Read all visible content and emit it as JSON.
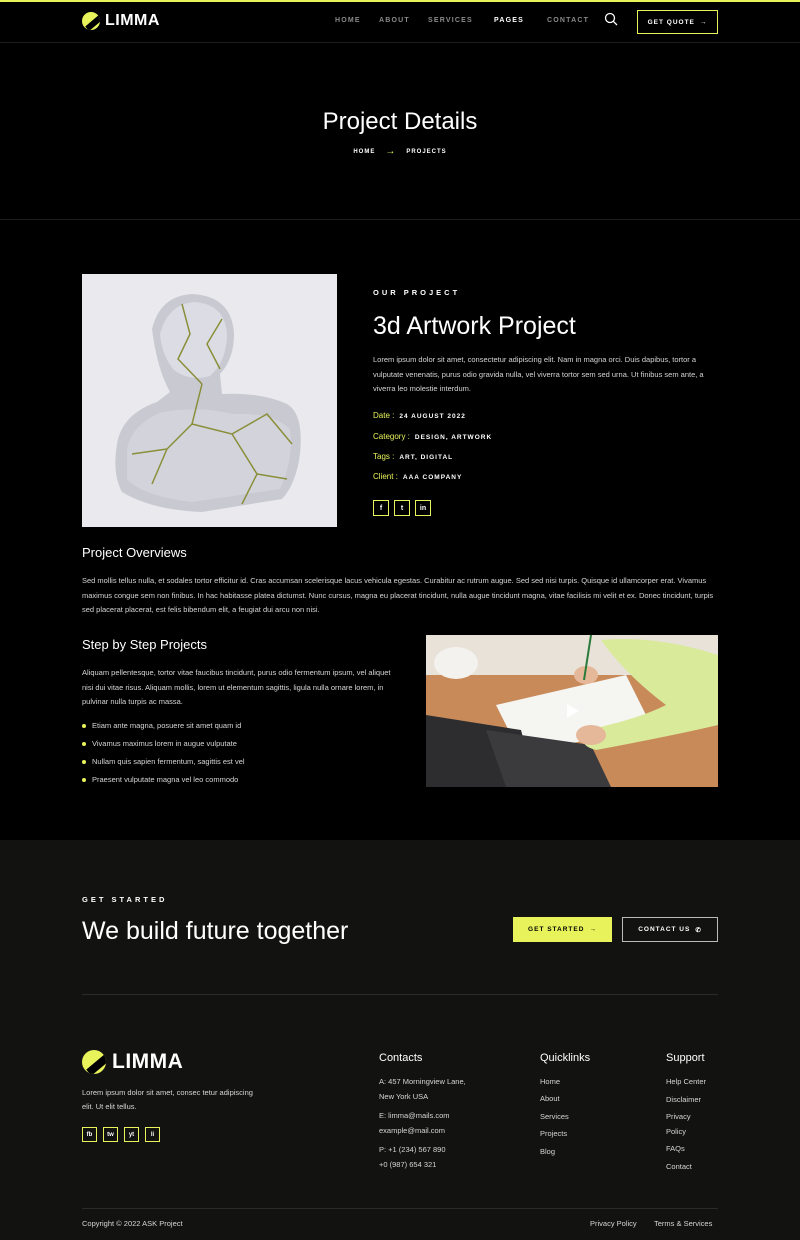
{
  "brand": {
    "name": "LIMMA",
    "accent": "#e8f35b"
  },
  "nav": {
    "items": [
      "HOME",
      "ABOUT",
      "SERVICES",
      "PAGES",
      "CONTACT"
    ],
    "active": "PAGES",
    "cta": "GET QUOTE"
  },
  "hero": {
    "title": "Project Details",
    "breadcrumb": [
      "HOME",
      "PROJECTS"
    ]
  },
  "project": {
    "eyebrow": "OUR PROJECT",
    "title": "3d Artwork Project",
    "description": "Lorem ipsum dolor sit amet, consectetur adipiscing elit. Nam in magna orci. Duis dapibus, tortor a vulputate venenatis, purus odio gravida nulla, vel viverra tortor sem sed urna. Ut finibus sem ante, a viverra leo molestie interdum.",
    "meta": [
      {
        "label": "Date :",
        "value": "24 AUGUST 2022"
      },
      {
        "label": "Category :",
        "value": "DESIGN, ARTWORK"
      },
      {
        "label": "Tags :",
        "value": "ART, DIGITAL"
      },
      {
        "label": "Client :",
        "value": "AAA COMPANY"
      }
    ],
    "socials": [
      "f",
      "t",
      "in"
    ]
  },
  "overview": {
    "title": "Project Overviews",
    "text": "Sed mollis tellus nulla, et sodales tortor efficitur id. Cras accumsan scelerisque lacus vehicula egestas. Curabitur ac rutrum augue. Sed sed nisi turpis. Quisque id ullamcorper erat. Vivamus maximus congue sem non finibus. In hac habitasse platea dictumst. Nunc cursus, magna eu placerat tincidunt, nulla augue tincidunt magna, vitae facilisis mi velit et ex. Donec tincidunt, turpis sed placerat placerat, est felis bibendum elit, a feugiat dui arcu non nisi."
  },
  "steps": {
    "title": "Step by Step Projects",
    "text": "Aliquam pellentesque, tortor vitae faucibus tincidunt, purus odio fermentum ipsum, vel aliquet nisi dui vitae risus. Aliquam mollis, lorem ut elementum sagittis, ligula nulla ornare lorem, in pulvinar nulla turpis ac massa.",
    "items": [
      "Etiam ante magna, posuere sit amet quam id",
      "Vivamus maximus lorem in augue vulputate",
      "Nullam quis sapien fermentum, sagittis est vel",
      "Praesent vulputate magna vel leo commodo"
    ]
  },
  "cta": {
    "eyebrow": "GET STARTED",
    "title": "We build future together",
    "primary": "GET STARTED",
    "secondary": "CONTACT US"
  },
  "footer": {
    "about": "Lorem ipsum dolor sit amet, consec tetur adipiscing elit. Ut elit tellus.",
    "socials": [
      "fb",
      "tw",
      "yt",
      "li"
    ],
    "contacts": {
      "title": "Contacts",
      "address": [
        "A: 457 Morningview Lane,",
        "New York USA"
      ],
      "email": [
        "E: limma@mails.com",
        "example@mail.com"
      ],
      "phone": [
        "P: +1 (234) 567 890",
        "+0 (987) 654 321"
      ]
    },
    "quicklinks": {
      "title": "Quicklinks",
      "items": [
        "Home",
        "About",
        "Services",
        "Projects",
        "Blog"
      ]
    },
    "support": {
      "title": "Support",
      "items": [
        "Help Center",
        "Disclaimer",
        "Privacy",
        "Policy",
        "FAQs",
        "Contact"
      ]
    },
    "copyright": "Copyright © 2022 ASK Project",
    "legal": [
      "Privacy Policy",
      "Terms & Services"
    ]
  }
}
